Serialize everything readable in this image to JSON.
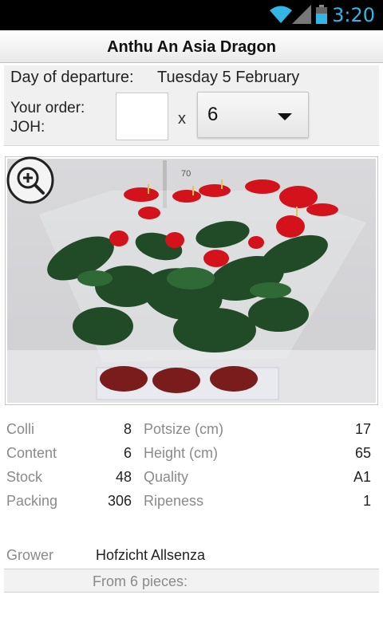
{
  "status_bar": {
    "time": "3:20",
    "icons": [
      "wifi-icon",
      "signal-icon",
      "battery-icon"
    ],
    "accent_color": "#33b5e5"
  },
  "title": "Anthu An Asia Dragon",
  "order": {
    "departure_label": "Day of departure:",
    "departure_value": "Tuesday 5 February",
    "order_label_line1": "Your order:",
    "order_label_line2": "JOH:",
    "quantity_value": "",
    "times_symbol": "x",
    "multiplier_selected": "6"
  },
  "photo": {
    "zoom_icon": "zoom-in-icon",
    "ruler_mark": "70"
  },
  "specs": [
    {
      "label_left": "Colli",
      "value_left": "8",
      "label_right": "Potsize (cm)",
      "value_right": "17"
    },
    {
      "label_left": "Content",
      "value_left": "6",
      "label_right": "Height (cm)",
      "value_right": "65"
    },
    {
      "label_left": "Stock",
      "value_left": "48",
      "label_right": "Quality",
      "value_right": "A1"
    },
    {
      "label_left": "Packing",
      "value_left": "306",
      "label_right": "Ripeness",
      "value_right": "1"
    }
  ],
  "grower": {
    "label": "Grower",
    "value": "Hofzicht Allsenza"
  },
  "pricing": {
    "from_text": "From 6 pieces:"
  }
}
